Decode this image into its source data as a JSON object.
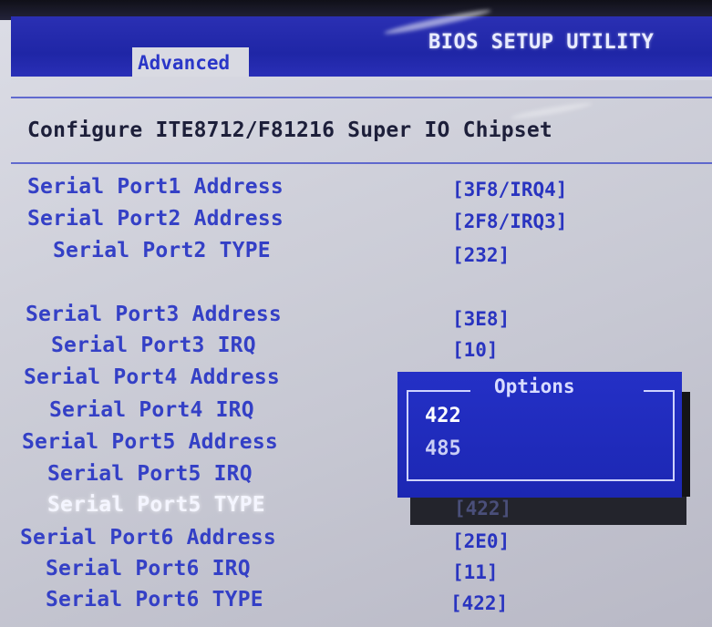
{
  "window": {
    "title": "BIOS SETUP UTILITY",
    "active_tab": "Advanced"
  },
  "section": {
    "heading": "Configure ITE8712/F81216 Super IO Chipset"
  },
  "settings": [
    {
      "label": "Serial Port1 Address",
      "value": "[3F8/IRQ4]"
    },
    {
      "label": "Serial Port2 Address",
      "value": "[2F8/IRQ3]"
    },
    {
      "label": "Serial Port2 TYPE",
      "value": "[232]"
    },
    {
      "label": "Serial Port3 Address",
      "value": "[3E8]"
    },
    {
      "label": "Serial Port3 IRQ",
      "value": "[10]"
    },
    {
      "label": "Serial Port4 Address",
      "value": ""
    },
    {
      "label": "Serial Port4 IRQ",
      "value": ""
    },
    {
      "label": "Serial Port5 Address",
      "value": ""
    },
    {
      "label": "Serial Port5 IRQ",
      "value": ""
    },
    {
      "label": "Serial Port5 TYPE",
      "value": "[422]"
    },
    {
      "label": "Serial Port6 Address",
      "value": "[2E0]"
    },
    {
      "label": "Serial Port6 IRQ",
      "value": "[11]"
    },
    {
      "label": "Serial Port6 TYPE",
      "value": "[422]"
    }
  ],
  "selected_setting": "Serial Port5 TYPE",
  "options_popup": {
    "title": "Options",
    "options": [
      "422",
      "485"
    ],
    "highlighted": "422"
  },
  "colors": {
    "title_bar": "#1f26a6",
    "label_text": "#3440c6",
    "selected_text": "#f4f5ff",
    "popup_bg": "#1c27b3"
  }
}
